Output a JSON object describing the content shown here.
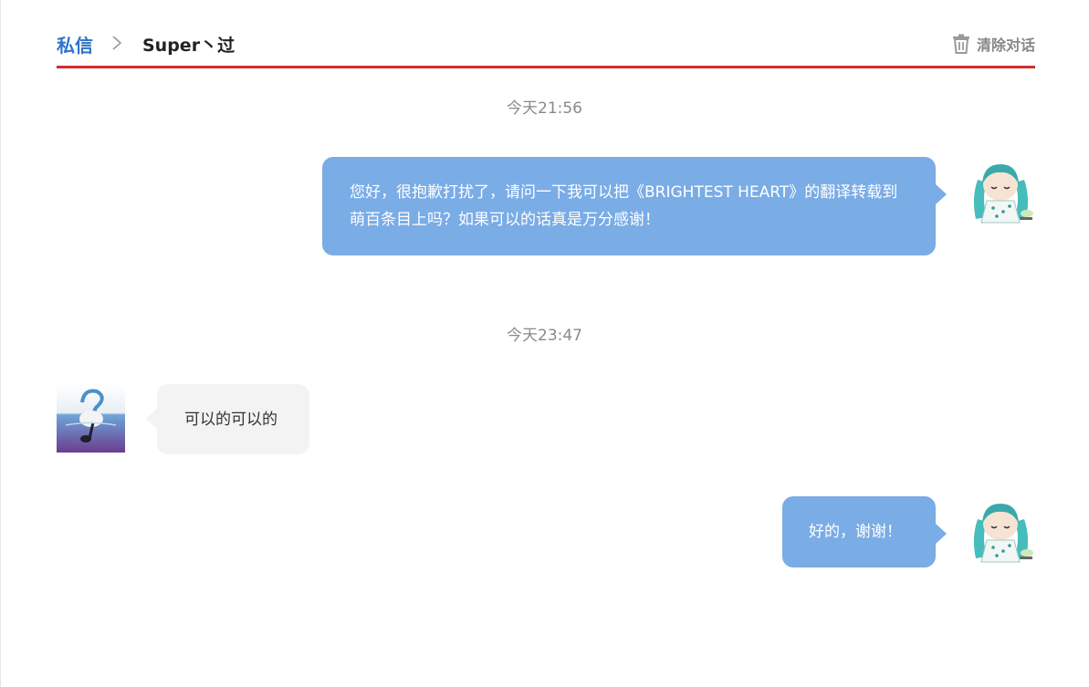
{
  "header": {
    "breadcrumb_root": "私信",
    "conversation_name": "Super丶过",
    "clear_label": "清除对话"
  },
  "colors": {
    "accent_red": "#cc2e2e",
    "link_blue": "#2e74c9",
    "my_bubble": "#7aace6",
    "their_bubble": "#f3f3f3"
  },
  "messages": [
    {
      "type": "timestamp",
      "text": "今天21:56"
    },
    {
      "type": "message",
      "sender": "me",
      "avatar": "anime-avatar",
      "text": "您好，很抱歉打扰了，请问一下我可以把《BRIGHTEST HEART》的翻译转载到萌百条目上吗？如果可以的话真是万分感谢！"
    },
    {
      "type": "timestamp",
      "text": "今天23:47"
    },
    {
      "type": "message",
      "sender": "other",
      "avatar": "music-note-avatar",
      "text": "可以的可以的"
    },
    {
      "type": "message",
      "sender": "me",
      "avatar": "anime-avatar",
      "text": "好的，谢谢！"
    }
  ]
}
